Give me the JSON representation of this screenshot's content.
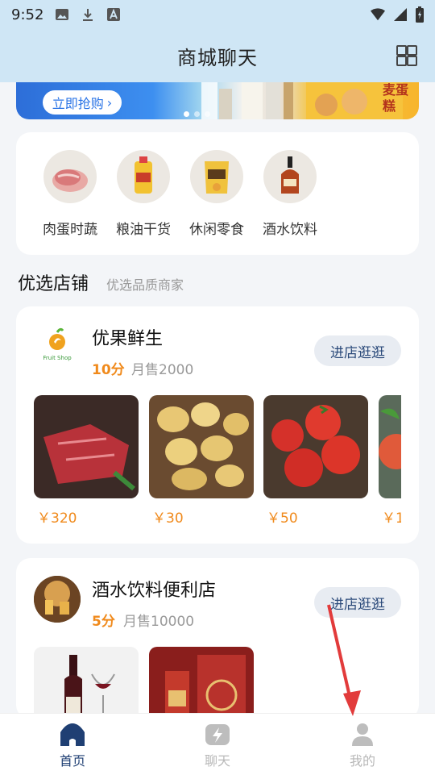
{
  "status_bar": {
    "time": "9:52"
  },
  "header": {
    "title": "商城聊天"
  },
  "banner": {
    "button_label": "立即抢购",
    "side_text": "麦蛋糕"
  },
  "categories": [
    {
      "label": "肉蛋时蔬",
      "icon": "meat-icon"
    },
    {
      "label": "粮油干货",
      "icon": "oil-bottle-icon"
    },
    {
      "label": "休闲零食",
      "icon": "snack-bag-icon"
    },
    {
      "label": "酒水饮料",
      "icon": "liquor-bottle-icon"
    }
  ],
  "section": {
    "title": "优选店铺",
    "subtitle": "优选品质商家"
  },
  "shops": [
    {
      "name": "优果鲜生",
      "logo_text": "Fruit Shop",
      "score": "10分",
      "sales": "月售2000",
      "enter_label": "进店逛逛",
      "products": [
        {
          "price": "￥320",
          "icon": "beef-image"
        },
        {
          "price": "￥30",
          "icon": "potato-image"
        },
        {
          "price": "￥50",
          "icon": "tomato-image"
        },
        {
          "price": "￥1",
          "icon": "apple-image"
        }
      ]
    },
    {
      "name": "酒水饮料便利店",
      "score": "5分",
      "sales": "月售10000",
      "enter_label": "进店逛逛",
      "products": [
        {
          "icon": "wine-image"
        },
        {
          "icon": "baijiu-gift-box-image"
        }
      ]
    }
  ],
  "tabbar": [
    {
      "label": "首页",
      "icon": "home-icon",
      "active": true
    },
    {
      "label": "聊天",
      "icon": "chat-bolt-icon",
      "active": false
    },
    {
      "label": "我的",
      "icon": "user-icon",
      "active": false
    }
  ],
  "colors": {
    "accent": "#f08a1c",
    "header_bg": "#cfe6f5",
    "tab_active": "#1f3f73",
    "tab_inactive": "#b8b8b8",
    "annotation_arrow": "#e23b3b"
  }
}
